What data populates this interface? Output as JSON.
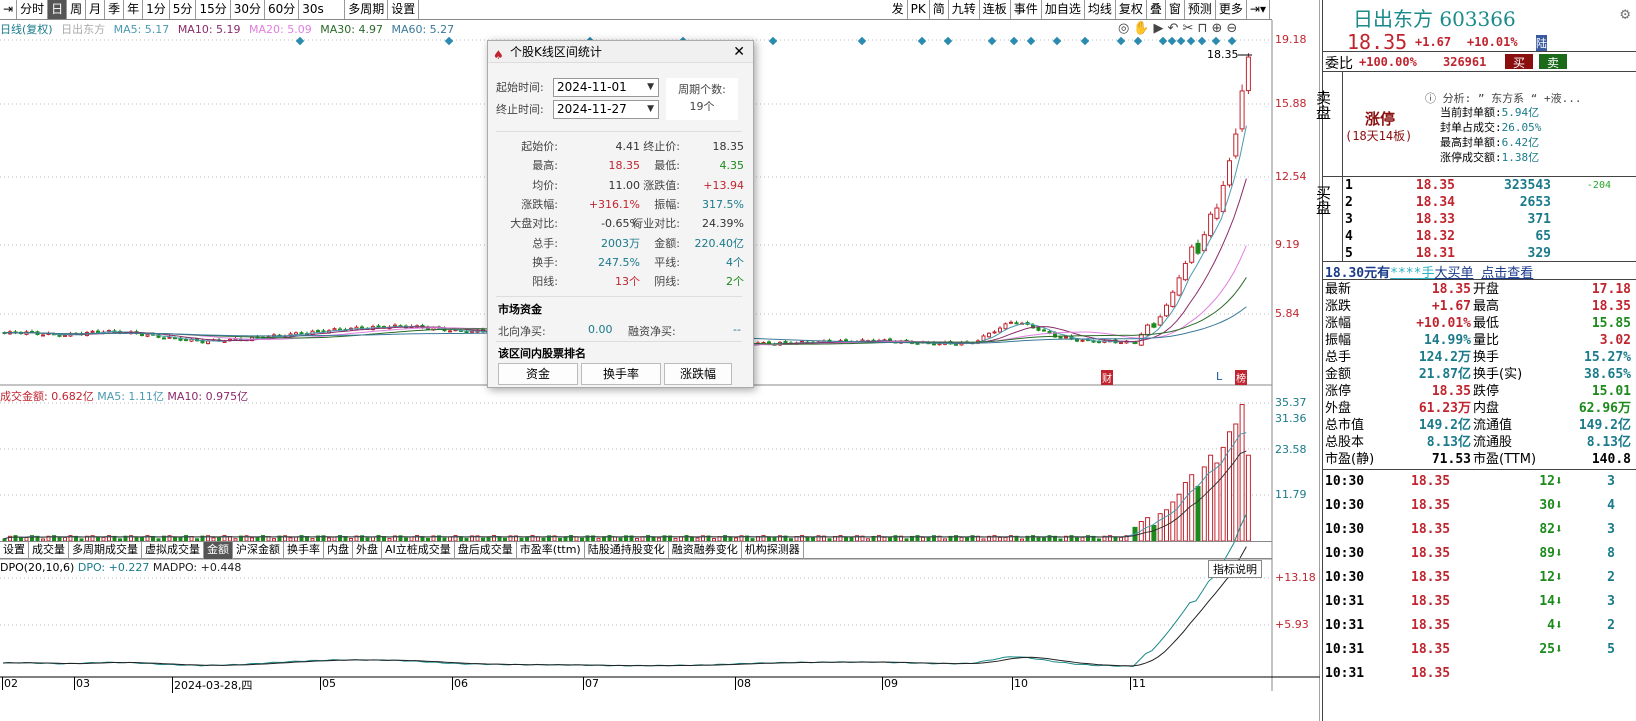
{
  "toolbar": {
    "items": [
      "分时",
      "日",
      "周",
      "月",
      "季",
      "年",
      "1分",
      "5分",
      "15分",
      "30分",
      "60分",
      "30s",
      "多周期",
      "设置"
    ],
    "active": "日",
    "right_items": [
      "发",
      "PK",
      "简",
      "九转",
      "连板",
      "事件",
      "加自选",
      "均线",
      "复权",
      "叠",
      "窗",
      "预测",
      "更多"
    ]
  },
  "info": {
    "period": "日线(复权)",
    "name": "日出东方",
    "ma5": "MA5: 5.17",
    "ma10": "MA10: 5.19",
    "ma20": "MA20: 5.09",
    "ma30": "MA30: 4.97",
    "ma60": "MA60: 5.27"
  },
  "price_axis": [
    "19.18",
    "15.88",
    "12.54",
    "9.19",
    "5.84"
  ],
  "last_price_label": "18.35",
  "vol_info": {
    "amount": "成交金额: 0.682亿",
    "ma5": "MA5: 1.11亿",
    "ma10": "MA10: 0.975亿"
  },
  "vol_axis": [
    "35.37",
    "31.36",
    "23.58",
    "11.79"
  ],
  "bottom_tabs": [
    "设置",
    "成交量",
    "多周期成交量",
    "虚拟成交量",
    "金额",
    "沪深金额",
    "换手率",
    "内盘",
    "外盘",
    "AI立桩成交量",
    "盘后成交量",
    "市盈率(ttm)",
    "陆股通持股变化",
    "融资融券变化",
    "机构探测器"
  ],
  "bottom_tab_active": "金额",
  "dpo": {
    "label": "DPO(20,10,6)",
    "dpo": "DPO: +0.227",
    "madpo": "MADPO: +0.448",
    "explain": "指标说明",
    "axis": [
      "+13.18",
      "+5.93"
    ]
  },
  "date_axis": [
    "02",
    "03",
    "2024-03-28,四",
    "05",
    "06",
    "07",
    "08",
    "09",
    "10",
    "11"
  ],
  "markers": {
    "cai": "财",
    "L": "L",
    "bang": "榜"
  },
  "chart_data": {
    "type": "candlestick",
    "pre_nov_closes": [
      4.9,
      4.95,
      4.85,
      4.8,
      4.9,
      5.0,
      4.95,
      4.85,
      4.7,
      4.6,
      4.5,
      4.55,
      4.6,
      4.7,
      4.8,
      4.9,
      5.0,
      5.1,
      5.15,
      5.2,
      5.25,
      5.2,
      5.1,
      5.0,
      5.0,
      4.95,
      4.9,
      4.85,
      4.8,
      4.7,
      4.6,
      4.5,
      4.45,
      4.4,
      4.35,
      4.3,
      4.3,
      4.35,
      4.4,
      4.4,
      4.45,
      4.45,
      4.5,
      4.5,
      4.55,
      4.5,
      4.45,
      4.4,
      4.4,
      4.45,
      5.0,
      5.5,
      5.2,
      4.8,
      4.6,
      4.5,
      4.5,
      4.45
    ],
    "nov_closes": [
      4.41,
      4.85,
      5.3,
      5.2,
      5.7,
      6.27,
      6.9,
      7.6,
      8.3,
      9.1,
      8.8,
      9.7,
      10.7,
      11.0,
      12.1,
      13.3,
      14.6,
      16.7,
      18.35
    ],
    "nov_amounts": [
      3.5,
      5,
      6,
      4,
      7,
      8,
      10,
      12,
      15,
      17,
      14,
      19,
      22,
      20,
      24,
      28,
      30,
      35,
      22
    ]
  },
  "dialog": {
    "title": "个股K线区间统计",
    "start_label": "起始时间:",
    "start": "2024-11-01",
    "end_label": "终止时间:",
    "end": "2024-11-27",
    "period_label": "周期个数:",
    "period": "19个",
    "stats": [
      [
        "起始价:",
        "4.41",
        "终止价:",
        "18.35"
      ],
      [
        "最高:",
        "18.35",
        "最低:",
        "4.35"
      ],
      [
        "均价:",
        "11.00",
        "涨跌值:",
        "+13.94"
      ],
      [
        "涨跌幅:",
        "+316.1%",
        "振幅:",
        "317.5%"
      ],
      [
        "大盘对比:",
        "-0.65%",
        "行业对比:",
        "24.39%"
      ],
      [
        "总手:",
        "2003万",
        "金额:",
        "220.40亿"
      ],
      [
        "换手:",
        "247.5%",
        "平线:",
        "4个"
      ],
      [
        "阳线:",
        "13个",
        "阴线:",
        "2个"
      ]
    ],
    "market_title": "市场资金",
    "north_label": "北向净买:",
    "north": "0.00",
    "margin_label": "融资净买:",
    "margin": "--",
    "rank_title": "该区间内股票排名",
    "buttons": [
      "资金",
      "换手率",
      "涨跌幅"
    ]
  },
  "right": {
    "name": "日出东方",
    "code": "603366",
    "price": "18.35",
    "change": "+1.67",
    "pct": "+10.01%",
    "tag": "陆",
    "weibi_label": "委比",
    "weibi": "+100.00%",
    "weicha": "326961",
    "buy": "买",
    "sell": "卖",
    "sell_side": "卖盘",
    "limit": "涨停",
    "limit_sub": "(18天14板)",
    "analysis": "分析: ” 东方系 “ +液...",
    "seal": [
      [
        "当前封单额:",
        "5.94亿"
      ],
      [
        "封单占成交:",
        "26.05%"
      ],
      [
        "最高封单额:",
        "6.42亿"
      ],
      [
        "涨停成交额:",
        "1.38亿"
      ]
    ],
    "buy_side": "买盘",
    "bids": [
      [
        "1",
        "18.35",
        "323543",
        "-204"
      ],
      [
        "2",
        "18.34",
        "2653",
        ""
      ],
      [
        "3",
        "18.33",
        "371",
        ""
      ],
      [
        "4",
        "18.32",
        "65",
        ""
      ],
      [
        "5",
        "18.31",
        "329",
        ""
      ]
    ],
    "bigorder": [
      "18.30元有",
      "****手",
      "大买单",
      "点击查看"
    ],
    "quote": [
      [
        "最新",
        "18.35",
        "开盘",
        "17.18"
      ],
      [
        "涨跌",
        "+1.67",
        "最高",
        "18.35"
      ],
      [
        "涨幅",
        "+10.01%",
        "最低",
        "15.85"
      ],
      [
        "振幅",
        "14.99%",
        "量比",
        "3.02"
      ],
      [
        "总手",
        "124.2万",
        "换手",
        "15.27%"
      ],
      [
        "金额",
        "21.87亿",
        "换手(实)",
        "38.65%"
      ],
      [
        "涨停",
        "18.35",
        "跌停",
        "15.01"
      ],
      [
        "外盘",
        "61.23万",
        "内盘",
        "62.96万"
      ],
      [
        "总市值",
        "149.2亿",
        "流通值",
        "149.2亿"
      ],
      [
        "总股本",
        "8.13亿",
        "流通股",
        "8.13亿"
      ],
      [
        "市盈(静)",
        "71.53",
        "市盈(TTM)",
        "140.8"
      ]
    ],
    "ticks": [
      [
        "10:30",
        "18.35",
        "12",
        "3"
      ],
      [
        "10:30",
        "18.35",
        "30",
        "4"
      ],
      [
        "10:30",
        "18.35",
        "82",
        "3"
      ],
      [
        "10:30",
        "18.35",
        "89",
        "8"
      ],
      [
        "10:30",
        "18.35",
        "12",
        "2"
      ],
      [
        "10:31",
        "18.35",
        "14",
        "3"
      ],
      [
        "10:31",
        "18.35",
        "4",
        "2"
      ],
      [
        "10:31",
        "18.35",
        "25",
        "5"
      ],
      [
        "10:31",
        "18.35",
        "",
        ""
      ]
    ]
  }
}
